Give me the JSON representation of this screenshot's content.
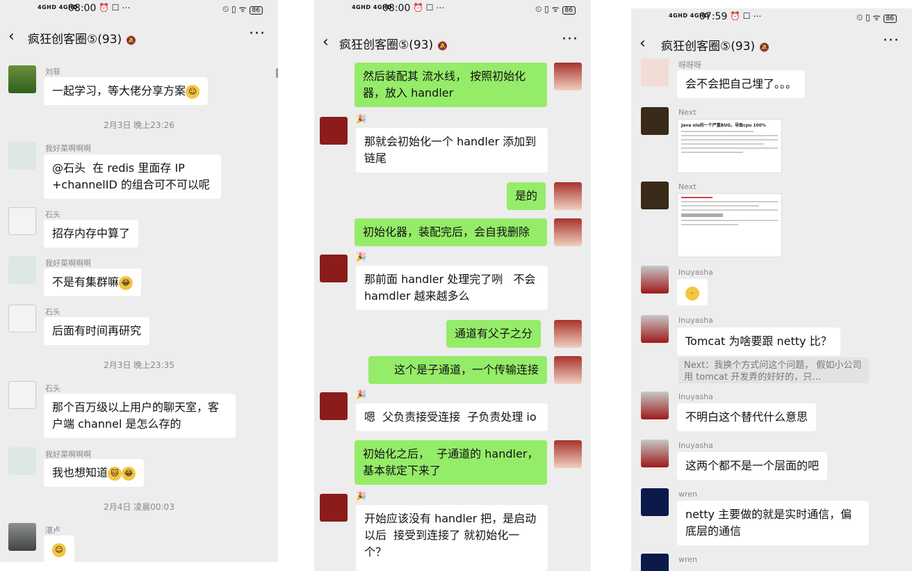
{
  "phone1": {
    "status": {
      "net": "4GHD 4GHD",
      "time": "08:00",
      "left_icons": "⏰ ☐ ⋯",
      "right_icons": "⏲ ▯ ᯤ",
      "battery": "86"
    },
    "nav": {
      "back": "‹",
      "title": "疯狂创客圈⑤(93)",
      "mute": "🔕",
      "more": "···"
    },
    "messages": [
      {
        "sender": "刘菲",
        "text": "一起学习，等大佬分享方案"
      },
      {
        "timestamp": "2月3日 晚上23:26"
      },
      {
        "sender": "我好菜啊啊啊",
        "text": "@石头  在 redis 里面存 IP +channelID 的组合可不可以呢"
      },
      {
        "sender": "石头",
        "text": "招存内存中算了"
      },
      {
        "sender": "我好菜啊啊啊",
        "text": "不是有集群嘛"
      },
      {
        "sender": "石头",
        "text": "后面有时间再研究"
      },
      {
        "timestamp": "2月3日 晚上23:35"
      },
      {
        "sender": "石头",
        "text": "那个百万级以上用户的聊天室，客户端 channel 是怎么存的"
      },
      {
        "sender": "我好菜啊啊啊",
        "text": "我也想知道"
      },
      {
        "timestamp": "2月4日 凌晨00:03"
      },
      {
        "sender": "湛卢",
        "text": ""
      }
    ]
  },
  "phone2": {
    "status": {
      "net": "4GHD 4GHD",
      "time": "08:00",
      "left_icons": "⏰ ☐ ⋯",
      "right_icons": "⏲ ▯ ᯤ",
      "battery": "86"
    },
    "nav": {
      "back": "‹",
      "title": "疯狂创客圈⑤(93)",
      "mute": "🔕",
      "more": "···"
    },
    "messages": [
      {
        "me": true,
        "text": "然后装配其 流水线， 按照初始化器，放入 handler"
      },
      {
        "sender": "🎉",
        "text": "那就会初始化一个 handler 添加到链尾"
      },
      {
        "me": true,
        "text": "是的"
      },
      {
        "me": true,
        "text": "初始化器，装配完后，会自我删除"
      },
      {
        "sender": "🎉",
        "text": "那前面 handler 处理完了咧   不会 hamdler 越来越多么"
      },
      {
        "me": true,
        "text": "通道有父子之分"
      },
      {
        "me": true,
        "text": "这个是子通道，一个传输连接"
      },
      {
        "sender": "🎉",
        "text": "嗯  父负责接受连接  子负责处理 io"
      },
      {
        "me": true,
        "text": "初始化之后，  子通道的 handler，基本就定下来了"
      },
      {
        "sender": "🎉",
        "text": "开始应该没有 handler 把，是启动以后  接受到连接了 就初始化一个？"
      }
    ]
  },
  "phone3": {
    "status": {
      "net": "4GHD 4GHD",
      "time": "07:59",
      "left_icons": "⏰ ☐ ⋯",
      "right_icons": "⏲ ▯ ᯤ",
      "battery": "86"
    },
    "nav": {
      "back": "‹",
      "title": "疯狂创客圈⑤(93)",
      "mute": "🔕",
      "more": "···"
    },
    "messages": [
      {
        "sender": "呀呀呀",
        "text": "会不会把自己埋了。。。"
      },
      {
        "sender": "Next",
        "image_title": "Java nio的一个严重BUG，导致cpu 100%"
      },
      {
        "sender": "Next",
        "image_title": ""
      },
      {
        "sender": "Inuyasha",
        "text": ""
      },
      {
        "sender": "Inuyasha",
        "text": "Tomcat 为啥要跟 netty 比？",
        "quote": "Next：我换个方式问这个问题，  假如小公司 用 tomcat 开发弄的好好的，只…"
      },
      {
        "sender": "Inuyasha",
        "text": "不明白这个替代什么意思"
      },
      {
        "sender": "Inuyasha",
        "text": "这两个都不是一个层面的吧"
      },
      {
        "sender": "wren",
        "text": "netty 主要做的就是实时通信，偏底层的通信"
      },
      {
        "sender": "wren",
        "text": ""
      }
    ]
  },
  "colors": {
    "chat_bg": "#ededed",
    "me_bubble": "#95ec69",
    "other_bubble": "#ffffff",
    "meta_text": "#888888"
  }
}
